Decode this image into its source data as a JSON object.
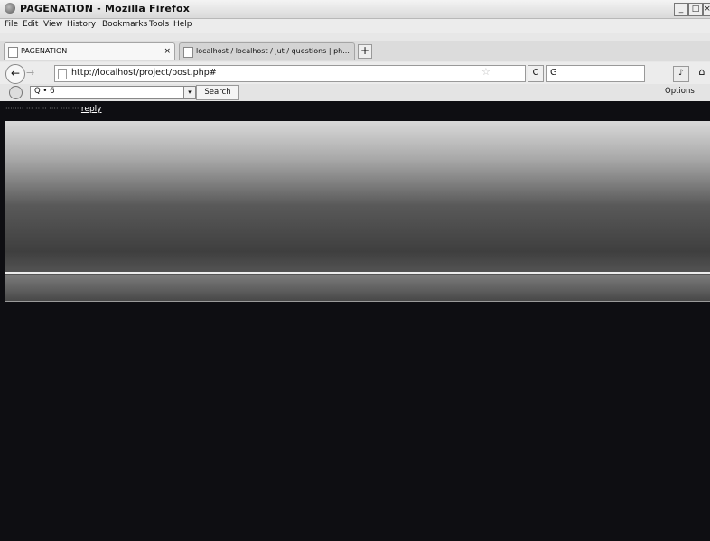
{
  "window": {
    "title": "PAGENATION - Mozilla Firefox",
    "controls": {
      "minimize": "_",
      "maximize": "□",
      "close": "×"
    }
  },
  "menu": {
    "items": [
      {
        "label": "File"
      },
      {
        "label": "Edit"
      },
      {
        "label": "View"
      },
      {
        "label": "History"
      },
      {
        "label": "Bookmarks"
      },
      {
        "label": "Tools"
      },
      {
        "label": "Help"
      }
    ]
  },
  "tabs": [
    {
      "label": "PAGENATION",
      "close": "×",
      "active": true
    },
    {
      "label": "localhost / localhost / jut / questions | ph...",
      "close": "×",
      "active": false
    }
  ],
  "new_tab": "+",
  "nav": {
    "back": "←",
    "forward": "→",
    "url": "http://localhost/project/post.php#",
    "bookmark_star": "☆",
    "reload": "C",
    "home": "⌂",
    "engine_icon": "G",
    "engine_placeholder": ""
  },
  "toolbar": {
    "search_value": "Q • 6",
    "dropdown": "▾",
    "search_button": "Search",
    "options": "Options"
  },
  "content": {
    "reply_link": "reply"
  },
  "icons": {
    "app": "firefox-icon",
    "back": "back-arrow-icon",
    "forward": "forward-arrow-icon",
    "reload": "reload-icon",
    "home": "home-icon",
    "star": "star-icon"
  },
  "colors": {
    "page_background": "#0e0e12",
    "banner_top": "#d9d9d9",
    "banner_bottom": "#3f3f3f"
  }
}
